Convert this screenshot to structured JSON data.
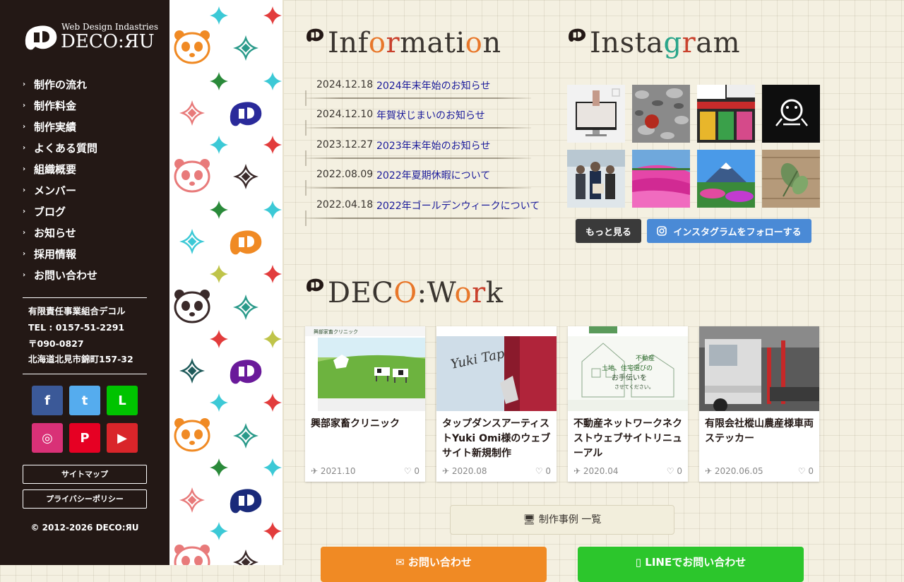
{
  "brand": {
    "tagline": "Web Design Indastries",
    "name": "DECO:ЯU"
  },
  "nav": [
    "制作の流れ",
    "制作料金",
    "制作実績",
    "よくある質問",
    "組織概要",
    "メンバー",
    "ブログ",
    "お知らせ",
    "採用情報",
    "お問い合わせ"
  ],
  "contact": {
    "org": "有限責任事業組合デコル",
    "tel": "TEL : 0157-51-2291",
    "zip": "〒090-0827",
    "address": "北海道北見市錦町157-32"
  },
  "sns": {
    "facebook": "f",
    "twitter": "t",
    "line": "L",
    "instagram": "◎",
    "pinterest": "P",
    "youtube": "▶"
  },
  "footer_links": {
    "sitemap": "サイトマップ",
    "privacy": "プライバシーポリシー"
  },
  "copyright": "© 2012-2026 DECO:ЯU",
  "information": {
    "title_parts": [
      "Inf",
      "o",
      "r",
      "mati",
      "o",
      "n"
    ],
    "items": [
      {
        "date": "2024.12.18",
        "title": "2024年末年始のお知らせ"
      },
      {
        "date": "2024.12.10",
        "title": "年賀状じまいのお知らせ"
      },
      {
        "date": "2023.12.27",
        "title": "2023年末年始のお知らせ"
      },
      {
        "date": "2022.08.09",
        "title": "2022年夏期休暇について"
      },
      {
        "date": "2022.04.18",
        "title": "2022年ゴールデンウィークについて"
      }
    ]
  },
  "instagram": {
    "title_parts": [
      "Insta",
      "g",
      "r",
      "am"
    ],
    "more_label": "もっと見る",
    "follow_label": "インスタグラムをフォローする"
  },
  "work": {
    "title_parts": [
      "DEC",
      "O",
      ":W",
      "o",
      "r",
      "k"
    ],
    "items": [
      {
        "title": "興部家畜クリニック",
        "date": "2021.10",
        "likes": "0"
      },
      {
        "title": "タップダンスアーティストYuki Omi様のウェブサイト新規制作",
        "date": "2020.08",
        "likes": "0"
      },
      {
        "title": "不動産ネットワークネクストウェブサイトリニューアル",
        "date": "2020.04",
        "likes": "0"
      },
      {
        "title": "有限会社樅山農産様車両ステッカー",
        "date": "2020.06.05",
        "likes": "0"
      }
    ],
    "thumb_texts": {
      "clinic": "興部家畜クリニック",
      "yuki": "Yuki Tap",
      "estate_1": "不動産",
      "estate_2": "土地、住宅選びの",
      "estate_3": "お手伝いを",
      "estate_4": "させてください。"
    },
    "list_label": "制作事例 一覧"
  },
  "cta": {
    "mail_label": "お問い合わせ",
    "line_label": "LINEでお問い合わせ"
  },
  "colors": {
    "sidebar_bg": "#231815",
    "accent_orange": "#e8772a",
    "accent_red": "#c9412d",
    "accent_green": "#2aa58a",
    "link": "#1a1a9a",
    "facebook": "#3b5998",
    "twitter": "#55acee",
    "line": "#00c300",
    "instagram": "#d93177",
    "pinterest": "#e60023",
    "youtube": "#d9252a",
    "insta_follow": "#4a8ad6",
    "cta_orange": "#f08a24",
    "cta_green": "#2cc62c"
  }
}
